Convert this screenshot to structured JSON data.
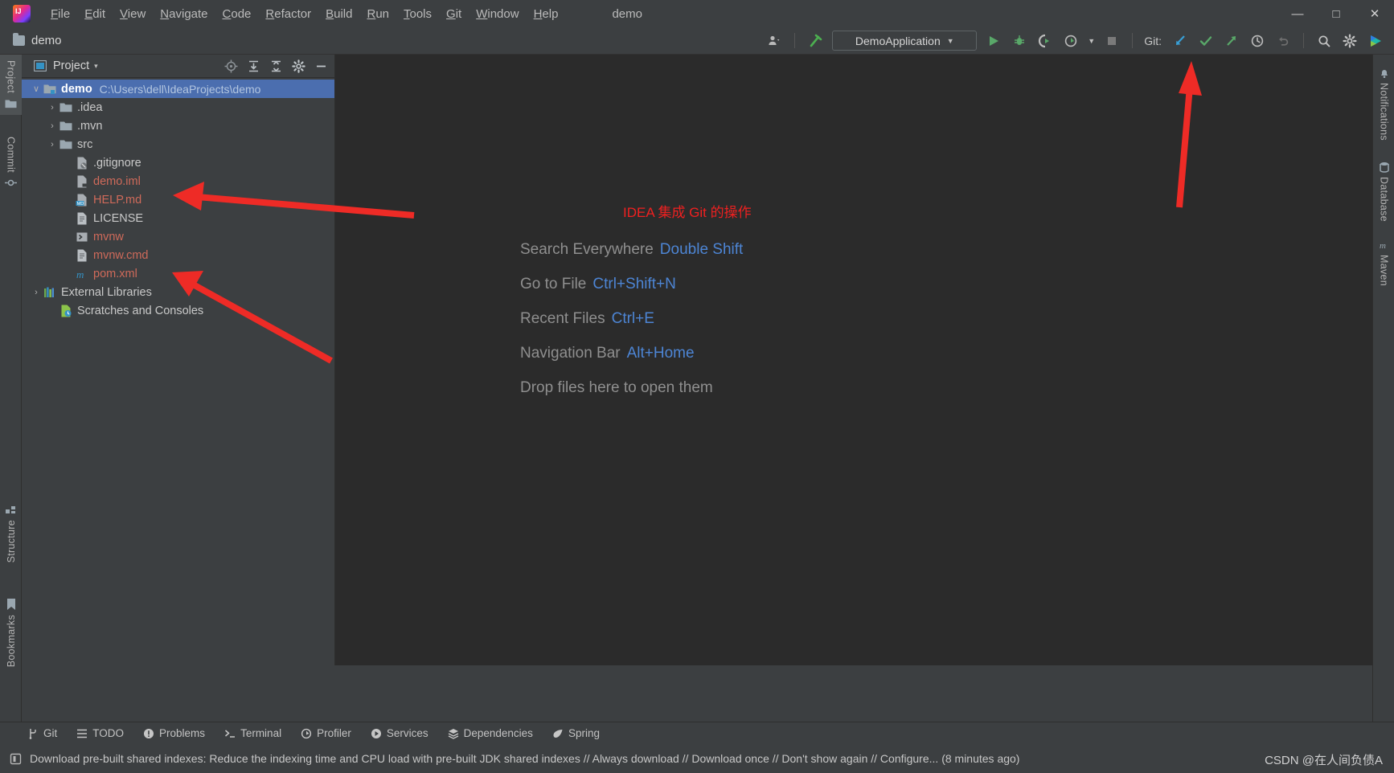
{
  "titlebar": {
    "logo_icon": "intellij-idea-logo",
    "menus": [
      {
        "mnemonic": "F",
        "rest": "ile"
      },
      {
        "mnemonic": "E",
        "rest": "dit"
      },
      {
        "mnemonic": "V",
        "rest": "iew"
      },
      {
        "mnemonic": "N",
        "rest": "avigate"
      },
      {
        "mnemonic": "C",
        "rest": "ode"
      },
      {
        "mnemonic": "R",
        "rest": "efactor"
      },
      {
        "mnemonic": "B",
        "rest": "uild"
      },
      {
        "mnemonic": "R",
        "rest": "un"
      },
      {
        "mnemonic": "T",
        "rest": "ools"
      },
      {
        "mnemonic": "G",
        "rest": "it"
      },
      {
        "mnemonic": "W",
        "rest": "indow"
      },
      {
        "mnemonic": "H",
        "rest": "elp"
      }
    ],
    "window_title": "demo",
    "minimize": "—",
    "maximize": "□",
    "close": "✕"
  },
  "toolbar": {
    "project_chip": "demo",
    "run_config": "DemoApplication",
    "git_label": "Git:",
    "icons": [
      "user-settings-icon",
      "build-hammer-icon",
      "run-icon",
      "debug-icon",
      "run-with-coverage-icon",
      "profiler-icon",
      "stop-icon",
      "git-update-icon",
      "git-commit-icon",
      "git-push-icon",
      "git-history-icon",
      "git-rollback-icon",
      "search-icon",
      "settings-gear-icon",
      "ide-services-icon"
    ]
  },
  "left_strip": {
    "top_tabs": [
      {
        "label": "Project",
        "icon": "project-folder-icon",
        "active": true
      },
      {
        "label": "Commit",
        "icon": "commit-icon",
        "active": false
      }
    ],
    "bottom_tabs": [
      {
        "label": "Structure",
        "icon": "structure-icon"
      },
      {
        "label": "Bookmarks",
        "icon": "bookmark-icon"
      }
    ]
  },
  "right_strip": {
    "tabs": [
      {
        "label": "Notifications",
        "icon": "notifications-bell-icon"
      },
      {
        "label": "Database",
        "icon": "database-icon"
      },
      {
        "label": "Maven",
        "icon": "maven-m-icon"
      }
    ]
  },
  "project_panel": {
    "title": "Project",
    "title_icon": "project-view-icon",
    "dropdown_caret": "▾",
    "actions": [
      "select-opened-file-icon",
      "expand-all-icon",
      "collapse-all-icon",
      "settings-gear-icon",
      "hide-panel-icon"
    ],
    "tree": [
      {
        "indent": 0,
        "arrow": "∨",
        "icon": "module-folder-icon",
        "label": "demo",
        "path": "C:\\Users\\dell\\IdeaProjects\\demo",
        "selected": true,
        "bold": true,
        "color": "white"
      },
      {
        "indent": 1,
        "arrow": "›",
        "icon": "folder-icon",
        "label": ".idea",
        "color": "gray"
      },
      {
        "indent": 1,
        "arrow": "›",
        "icon": "folder-icon",
        "label": ".mvn",
        "color": "gray"
      },
      {
        "indent": 1,
        "arrow": "›",
        "icon": "folder-icon",
        "label": "src",
        "color": "gray"
      },
      {
        "indent": 2,
        "arrow": "",
        "icon": "gitignore-file-icon",
        "label": ".gitignore",
        "color": "gray"
      },
      {
        "indent": 2,
        "arrow": "",
        "icon": "iml-file-icon",
        "label": "demo.iml",
        "color": "red"
      },
      {
        "indent": 2,
        "arrow": "",
        "icon": "markdown-file-icon",
        "label": "HELP.md",
        "color": "red"
      },
      {
        "indent": 2,
        "arrow": "",
        "icon": "text-file-icon",
        "label": "LICENSE",
        "color": "gray"
      },
      {
        "indent": 2,
        "arrow": "",
        "icon": "shell-script-icon",
        "label": "mvnw",
        "color": "red"
      },
      {
        "indent": 2,
        "arrow": "",
        "icon": "text-file-icon",
        "label": "mvnw.cmd",
        "color": "red"
      },
      {
        "indent": 2,
        "arrow": "",
        "icon": "maven-pom-icon",
        "label": "pom.xml",
        "color": "red"
      },
      {
        "indent": 0,
        "arrow": "›",
        "icon": "external-libraries-icon",
        "label": "External Libraries",
        "color": "gray"
      },
      {
        "indent": 1,
        "arrow": "",
        "icon": "scratches-icon",
        "label": "Scratches and Consoles",
        "color": "gray"
      }
    ]
  },
  "editor": {
    "hints": [
      {
        "label": "Search Everywhere",
        "shortcut": "Double Shift"
      },
      {
        "label": "Go to File",
        "shortcut": "Ctrl+Shift+N"
      },
      {
        "label": "Recent Files",
        "shortcut": "Ctrl+E"
      },
      {
        "label": "Navigation Bar",
        "shortcut": "Alt+Home"
      },
      {
        "label": "Drop files here to open them",
        "shortcut": ""
      }
    ]
  },
  "annotations": {
    "git_note": "IDEA 集成 Git 的操作",
    "arrow_color": "#ee2b26"
  },
  "tool_window_bar": [
    {
      "label": "Git",
      "icon": "git-branch-icon"
    },
    {
      "label": "TODO",
      "icon": "todo-list-icon"
    },
    {
      "label": "Problems",
      "icon": "problems-warning-icon"
    },
    {
      "label": "Terminal",
      "icon": "terminal-icon"
    },
    {
      "label": "Profiler",
      "icon": "profiler-icon"
    },
    {
      "label": "Services",
      "icon": "services-play-icon"
    },
    {
      "label": "Dependencies",
      "icon": "dependencies-layers-icon"
    },
    {
      "label": "Spring",
      "icon": "spring-leaf-icon"
    }
  ],
  "status_bar": {
    "icon": "notification-balloon-icon",
    "text": "Download pre-built shared indexes: Reduce the indexing time and CPU load with pre-built JDK shared indexes // Always download // Download once // Don't show again // Configure... (8 minutes ago)"
  },
  "watermark": "CSDN @在人间负债A",
  "colors": {
    "accent_blue": "#4b6eaf",
    "link_blue": "#4d85d4",
    "untracked_red": "#cf6a5a",
    "annotation_red": "#ef2020",
    "panel_bg": "#3c3f41",
    "editor_bg": "#2b2b2b"
  }
}
